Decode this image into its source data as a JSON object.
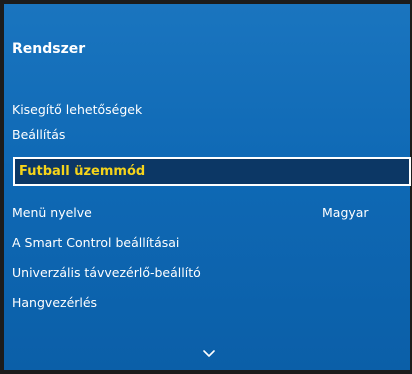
{
  "menu": {
    "title": "Rendszer",
    "items": [
      {
        "label": "Kisegítő lehetőségek"
      },
      {
        "label": "Beállítás"
      },
      {
        "label": "Futball üzemmód",
        "selected": true
      },
      {
        "label": "Menü nyelve",
        "value": "Magyar"
      },
      {
        "label": "A Smart Control beállításai"
      },
      {
        "label": "Univerzális távvezérlő-beállító"
      },
      {
        "label": "Hangvezérlés"
      }
    ],
    "scroll_icon": "chevron-down-icon"
  },
  "colors": {
    "panel": "#1270BA",
    "selected_background": "#0C3765",
    "selected_text": "#F5D31A",
    "text": "#FFFFFF",
    "frame": "#1C1C1C"
  }
}
